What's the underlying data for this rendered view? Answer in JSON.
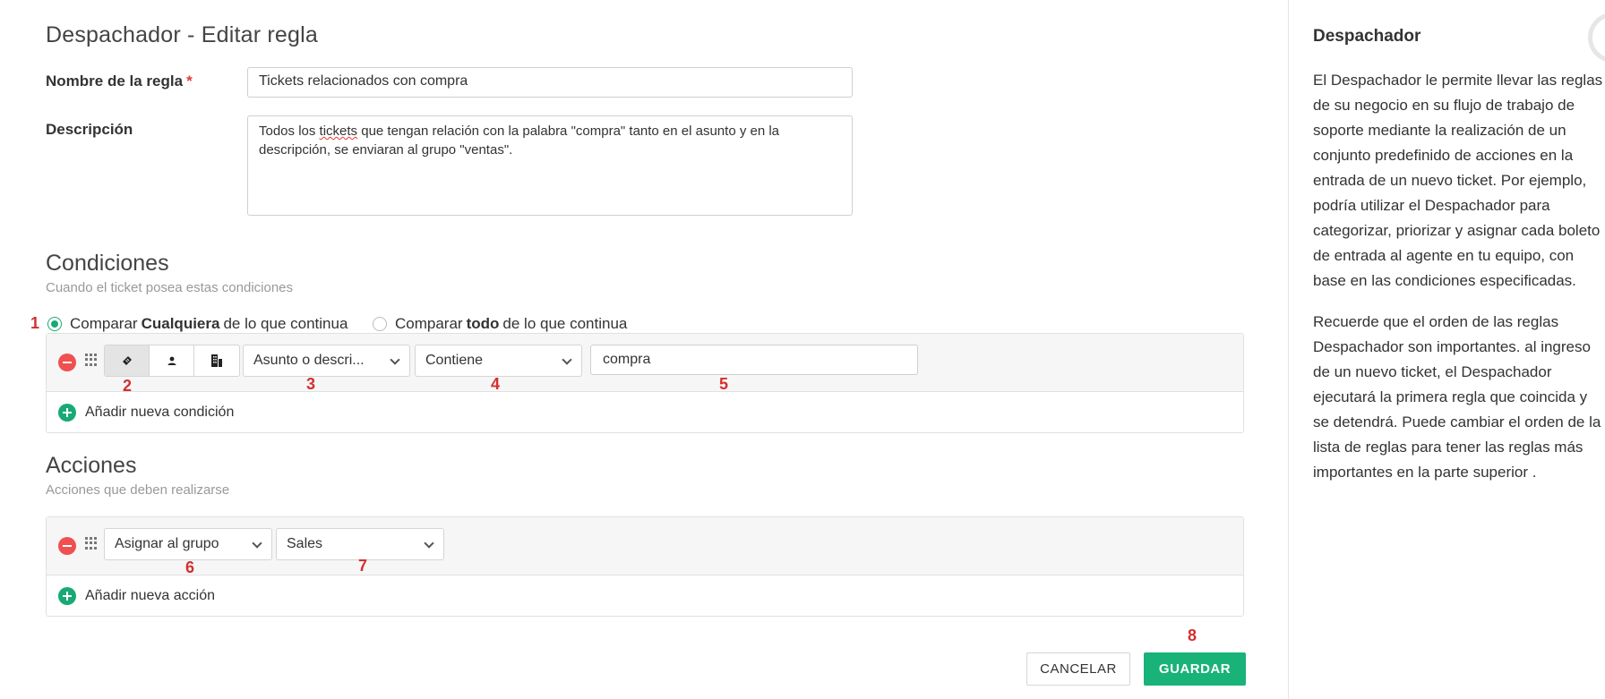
{
  "page": {
    "title": "Despachador - Editar regla"
  },
  "form": {
    "name_label": "Nombre de la regla",
    "required_mark": "*",
    "name_value": "Tickets relacionados con compra",
    "description_label": "Descripción",
    "description_before": "Todos los ",
    "description_misspelled": "tickets",
    "description_after": " que tengan relación con la palabra \"compra\" tanto en el asunto y en la descripción, se enviaran al grupo \"ventas\"."
  },
  "conditions": {
    "title": "Condiciones",
    "subtitle": "Cuando el ticket posea estas condiciones",
    "match_any_prefix": "Comparar ",
    "match_any_bold": "Cualquiera",
    "match_any_suffix": " de lo que continua",
    "match_all_prefix": "Comparar ",
    "match_all_bold": "todo",
    "match_all_suffix": " de lo que continua",
    "selected_match": "any",
    "row": {
      "field": "Asunto o descri...",
      "operator": "Contiene",
      "value": "compra"
    },
    "add_label": "Añadir nueva condición"
  },
  "actions": {
    "title": "Acciones",
    "subtitle": "Acciones que deben realizarse",
    "row": {
      "action": "Asignar al grupo",
      "value": "Sales"
    },
    "add_label": "Añadir nueva acción"
  },
  "annotations": [
    "1",
    "2",
    "3",
    "4",
    "5",
    "6",
    "7",
    "8"
  ],
  "buttons": {
    "cancel": "CANCELAR",
    "save": "GUARDAR"
  },
  "sidebar": {
    "title": "Despachador",
    "paragraph1": "El Despachador le permite llevar las reglas de su negocio en su flujo de trabajo de soporte mediante la realización de un conjunto predefinido de acciones en la entrada de un nuevo ticket. Por ejemplo, podría utilizar el Despachador para categorizar, priorizar y asignar cada boleto de entrada al agente en tu equipo, con base en las condiciones especificadas.",
    "paragraph2": "Recuerde que el orden de las reglas Despachador son importantes. al ingreso de un nuevo ticket, el Despachador ejecutará la primera regla que coincida y se detendrá. Puede cambiar el orden de la lista de reglas para tener las reglas más importantes en la parte superior ."
  },
  "colors": {
    "accent": "#19b278",
    "danger": "#f05050",
    "annotation": "#d32f2f"
  }
}
